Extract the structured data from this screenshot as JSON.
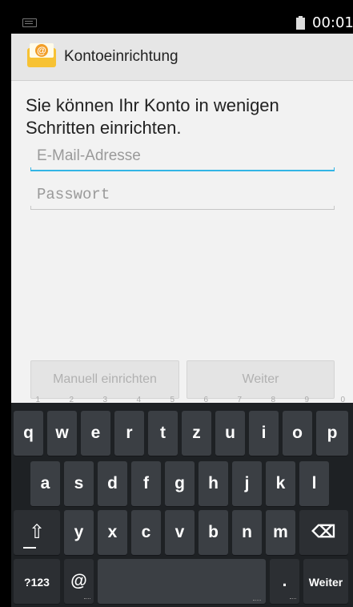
{
  "status_bar": {
    "time": "00:01",
    "icons": [
      "keyboard-icon",
      "battery-icon"
    ]
  },
  "action_bar": {
    "title": "Kontoeinrichtung",
    "icon": "email-app-icon"
  },
  "content": {
    "instructions": "Sie können Ihr Konto in wenigen Schritten einrichten.",
    "email": {
      "placeholder": "E-Mail-Adresse",
      "value": ""
    },
    "password": {
      "placeholder": "Passwort",
      "value": ""
    }
  },
  "buttons": {
    "manual_setup": "Manuell einrichten",
    "next": "Weiter"
  },
  "keyboard": {
    "row1": [
      {
        "label": "q",
        "hint": "1"
      },
      {
        "label": "w",
        "hint": "2"
      },
      {
        "label": "e",
        "hint": "3"
      },
      {
        "label": "r",
        "hint": "4"
      },
      {
        "label": "t",
        "hint": "5"
      },
      {
        "label": "z",
        "hint": "6"
      },
      {
        "label": "u",
        "hint": "7"
      },
      {
        "label": "i",
        "hint": "8"
      },
      {
        "label": "o",
        "hint": "9"
      },
      {
        "label": "p",
        "hint": "0"
      }
    ],
    "row2": [
      "a",
      "s",
      "d",
      "f",
      "g",
      "h",
      "j",
      "k",
      "l"
    ],
    "row3": [
      "y",
      "x",
      "c",
      "v",
      "b",
      "n",
      "m"
    ],
    "shift_label": "⇧",
    "backspace_label": "⌫",
    "symbols_label": "?123",
    "at_label": "@",
    "period_label": ".",
    "action_label": "Weiter"
  },
  "colors": {
    "accent": "#33b5e5",
    "keyboard_bg": "#1e2124",
    "key_bg": "#3b3f44"
  }
}
